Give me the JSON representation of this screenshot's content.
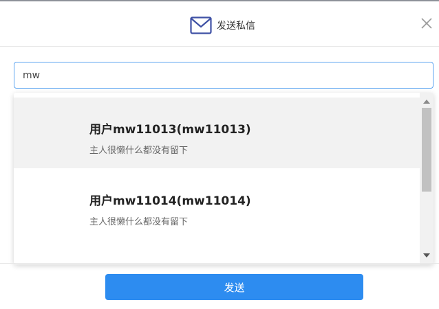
{
  "dialog": {
    "title": "发送私信",
    "icon": "envelope-icon",
    "close_icon": "close-icon"
  },
  "search": {
    "value": "mw",
    "placeholder": ""
  },
  "results": [
    {
      "name": "用户mw11013(mw11013)",
      "desc": "主人很懒什么都没有留下",
      "highlighted": true
    },
    {
      "name": "用户mw11014(mw11014)",
      "desc": "主人很懒什么都没有留下",
      "highlighted": false
    }
  ],
  "footer": {
    "send_label": "发送"
  },
  "colors": {
    "accent": "#2d8cf0",
    "input_border": "#5aa3f0",
    "highlight_row": "#f2f2f2",
    "icon": "#3f51a5"
  }
}
